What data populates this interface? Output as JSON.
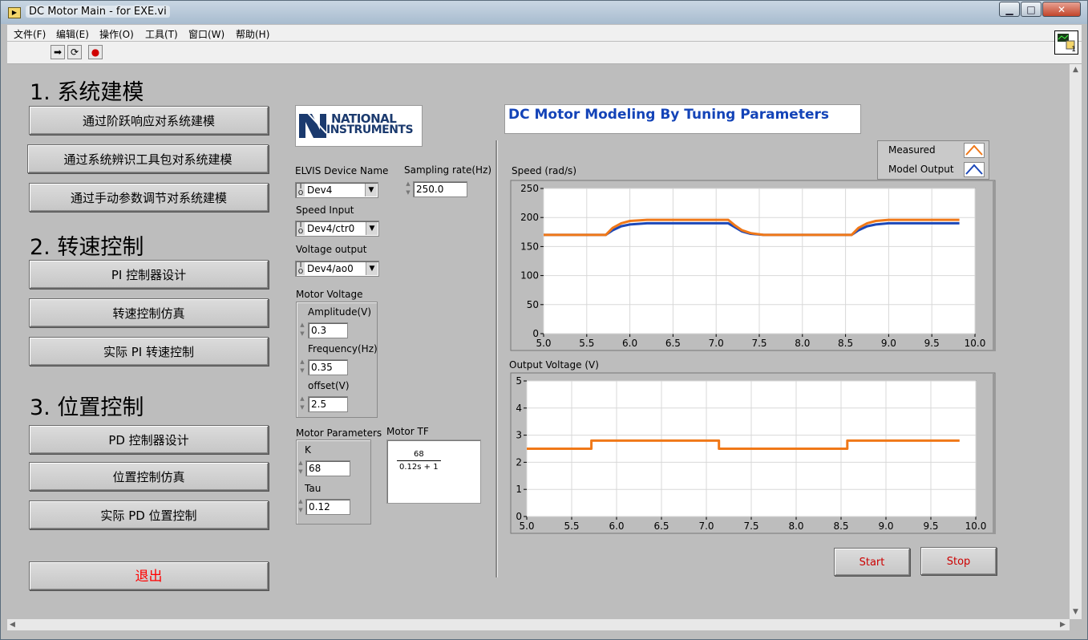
{
  "window": {
    "title": "DC Motor Main - for EXE.vi",
    "app_icon": "labview-vi-icon",
    "min_glyph": "▁",
    "max_glyph": "□",
    "close_glyph": "✕"
  },
  "menu": [
    "文件(F)",
    "编辑(E)",
    "操作(O)",
    "工具(T)",
    "窗口(W)",
    "帮助(H)"
  ],
  "toolbar": {
    "run_icon": "➡",
    "run_cont_icon": "⟳",
    "abort_icon": "●",
    "vi_icon_label": "1"
  },
  "left_panel": {
    "section1": "1. 系统建模",
    "btn_step": "通过阶跃响应对系统建模",
    "btn_sysid": "通过系统辨识工具包对系统建模",
    "btn_manual": "通过手动参数调节对系统建模",
    "section2": "2. 转速控制",
    "btn_pi_design": "PI 控制器设计",
    "btn_speed_sim": "转速控制仿真",
    "btn_speed_real": "实际 PI 转速控制",
    "section3": "3. 位置控制",
    "btn_pd_design": "PD 控制器设计",
    "btn_pos_sim": "位置控制仿真",
    "btn_pos_real": "实际 PD 位置控制",
    "btn_exit": "退出"
  },
  "logo": {
    "line1": "NATIONAL",
    "line2": "INSTRUMENTS"
  },
  "header_title": "DC Motor Modeling By Tuning Parameters",
  "config": {
    "elvis_label": "ELVIS Device Name",
    "elvis_value": "Dev4",
    "sampling_label": "Sampling rate(Hz)",
    "sampling_value": "250.0",
    "speed_input_label": "Speed Input",
    "speed_input_value": "Dev4/ctr0",
    "voltage_output_label": "Voltage output",
    "voltage_output_value": "Dev4/ao0",
    "io_glyph": "I/O"
  },
  "motor_voltage": {
    "label": "Motor Voltage",
    "amplitude_label": "Amplitude(V)",
    "amplitude_value": "0.3",
    "frequency_label": "Frequency(Hz)",
    "frequency_value": "0.35",
    "offset_label": "offset(V)",
    "offset_value": "2.5"
  },
  "motor_params": {
    "label": "Motor Parameters",
    "k_label": "K",
    "k_value": "68",
    "tau_label": "Tau",
    "tau_value": "0.12"
  },
  "motor_tf": {
    "label": "Motor TF",
    "numerator": "68",
    "denominator": "0.12s + 1"
  },
  "legend": {
    "measured": "Measured",
    "model_output": "Model Output"
  },
  "buttons": {
    "start": "Start",
    "stop": "Stop"
  },
  "colors": {
    "measured": "#f07818",
    "model": "#1c48b8",
    "title_text": "#1444b8",
    "exit_text": "#ff0000"
  },
  "chart_data": [
    {
      "type": "line",
      "ylabel": "Speed (rad/s)",
      "xlim": [
        5.0,
        10.0
      ],
      "ylim": [
        0,
        250
      ],
      "xticks": [
        "5.0",
        "5.5",
        "6.0",
        "6.5",
        "7.0",
        "7.5",
        "8.0",
        "8.5",
        "9.0",
        "9.5",
        "10.0"
      ],
      "yticks": [
        "0",
        "50",
        "100",
        "150",
        "200",
        "250"
      ],
      "grid": true,
      "series": [
        {
          "name": "Measured",
          "x": [
            5.0,
            5.72,
            5.8,
            5.9,
            6.0,
            6.2,
            7.14,
            7.22,
            7.3,
            7.4,
            7.55,
            8.57,
            8.65,
            8.75,
            8.85,
            9.0,
            9.2,
            9.82
          ],
          "y": [
            170,
            170,
            182,
            190,
            194,
            196,
            196,
            186,
            178,
            173,
            170,
            170,
            182,
            190,
            194,
            196,
            196,
            196
          ]
        },
        {
          "name": "Model Output",
          "x": [
            5.0,
            5.72,
            5.8,
            5.9,
            6.0,
            6.2,
            7.14,
            7.22,
            7.3,
            7.4,
            7.55,
            8.57,
            8.65,
            8.75,
            8.85,
            9.0,
            9.2,
            9.82
          ],
          "y": [
            170,
            170,
            178,
            185,
            188,
            190,
            190,
            183,
            176,
            172,
            170,
            170,
            178,
            185,
            188,
            190,
            190,
            190
          ]
        }
      ]
    },
    {
      "type": "line",
      "ylabel": "Output Voltage (V)",
      "xlim": [
        5.0,
        10.0
      ],
      "ylim": [
        0,
        5
      ],
      "xticks": [
        "5.0",
        "5.5",
        "6.0",
        "6.5",
        "7.0",
        "7.5",
        "8.0",
        "8.5",
        "9.0",
        "9.5",
        "10.0"
      ],
      "yticks": [
        "0",
        "1",
        "2",
        "3",
        "4",
        "5"
      ],
      "grid": true,
      "series": [
        {
          "name": "Measured",
          "x": [
            5.0,
            5.72,
            5.72,
            7.14,
            7.14,
            8.57,
            8.57,
            9.82
          ],
          "y": [
            2.5,
            2.5,
            2.8,
            2.8,
            2.5,
            2.5,
            2.8,
            2.8
          ]
        }
      ]
    }
  ]
}
